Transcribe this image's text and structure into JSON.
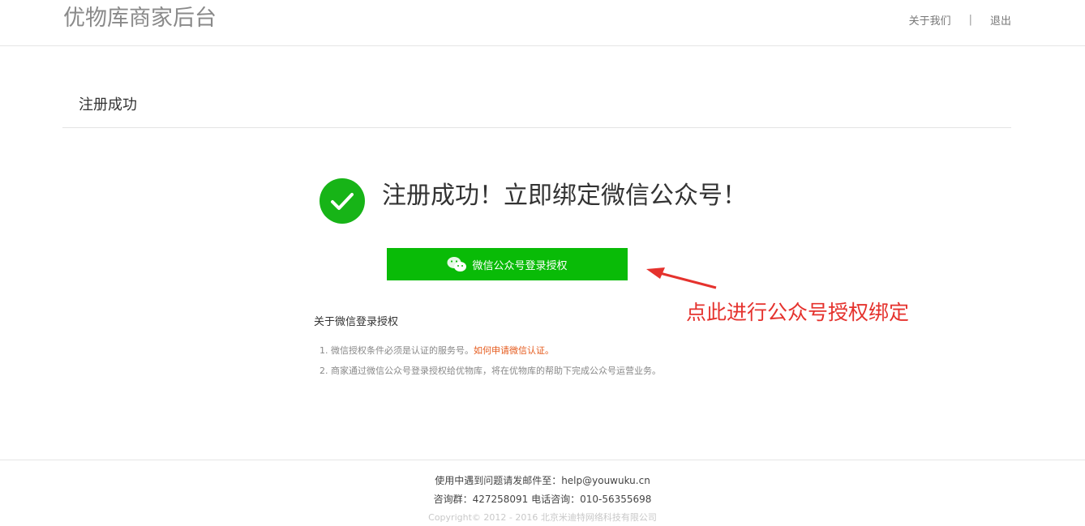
{
  "header": {
    "brand": "优物库商家后台",
    "nav": {
      "about": "关于我们",
      "separator": "|",
      "logout": "退出"
    }
  },
  "section": {
    "title": "注册成功"
  },
  "success": {
    "headline": "注册成功！立即绑定微信公众号！",
    "icon": "check-circle-icon"
  },
  "wechat_button": {
    "label": "微信公众号登录授权",
    "icon": "wechat-icon"
  },
  "annotation": {
    "text": "点此进行公众号授权绑定"
  },
  "about": {
    "title": "关于微信登录授权",
    "item1_prefix": "1. 微信授权条件必须是认证的服务号。",
    "item1_link": "如何申请微信认证。",
    "item2": "2. 商家通过微信公众号登录授权给优物库，将在优物库的帮助下完成公众号运营业务。"
  },
  "footer": {
    "line1": "使用中遇到问题请发邮件至：help@youwuku.cn",
    "line2": "咨询群：427258091 电话咨询：010-56355698",
    "line3": "Copyright© 2012 - 2016 北京米迪特网络科技有限公司"
  },
  "colors": {
    "accent_green": "#09bb07",
    "success_green": "#17b417",
    "annotation_red": "#e5322d",
    "link_orange": "#e55a1c"
  }
}
